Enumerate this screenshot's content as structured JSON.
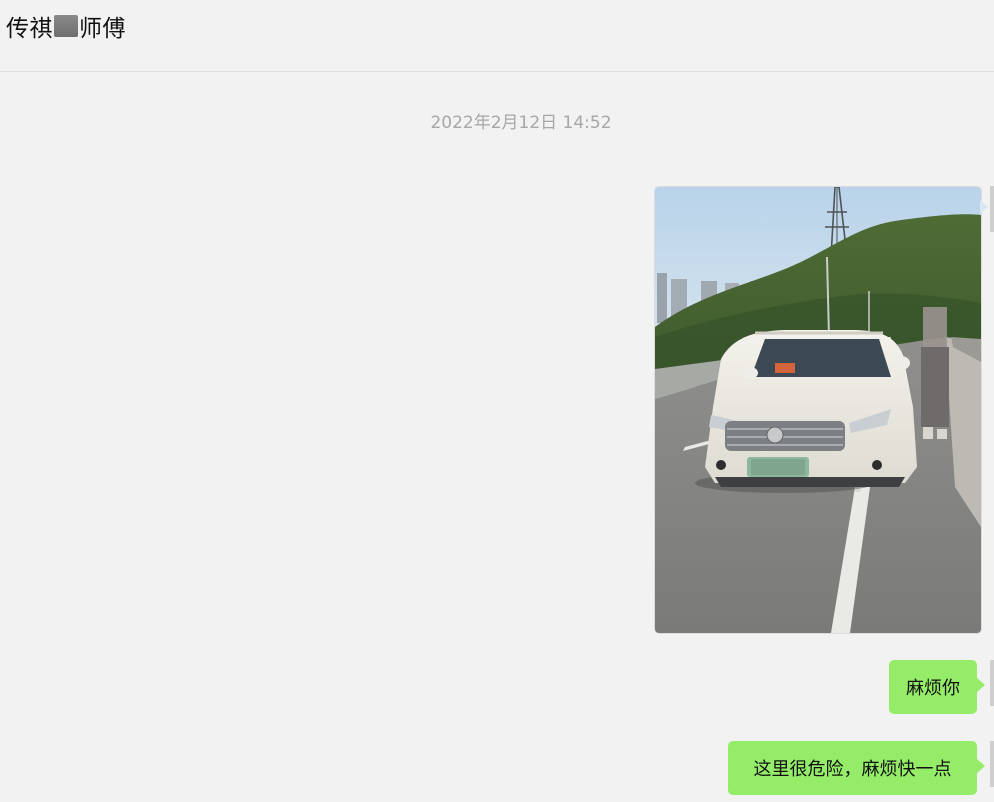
{
  "header": {
    "title_prefix": "传祺",
    "title_suffix": "师傅"
  },
  "chat": {
    "timestamp": "2022年2月12日 14:52",
    "messages": [
      {
        "type": "image",
        "alt": "photo-of-white-suv-on-highway"
      },
      {
        "type": "text",
        "text": "麻烦你"
      },
      {
        "type": "text",
        "text": "这里很危险，麻烦快一点"
      }
    ]
  },
  "colors": {
    "background": "#f2f2f2",
    "bubble_green": "#95ec69",
    "timestamp_gray": "#a7a7a7"
  }
}
